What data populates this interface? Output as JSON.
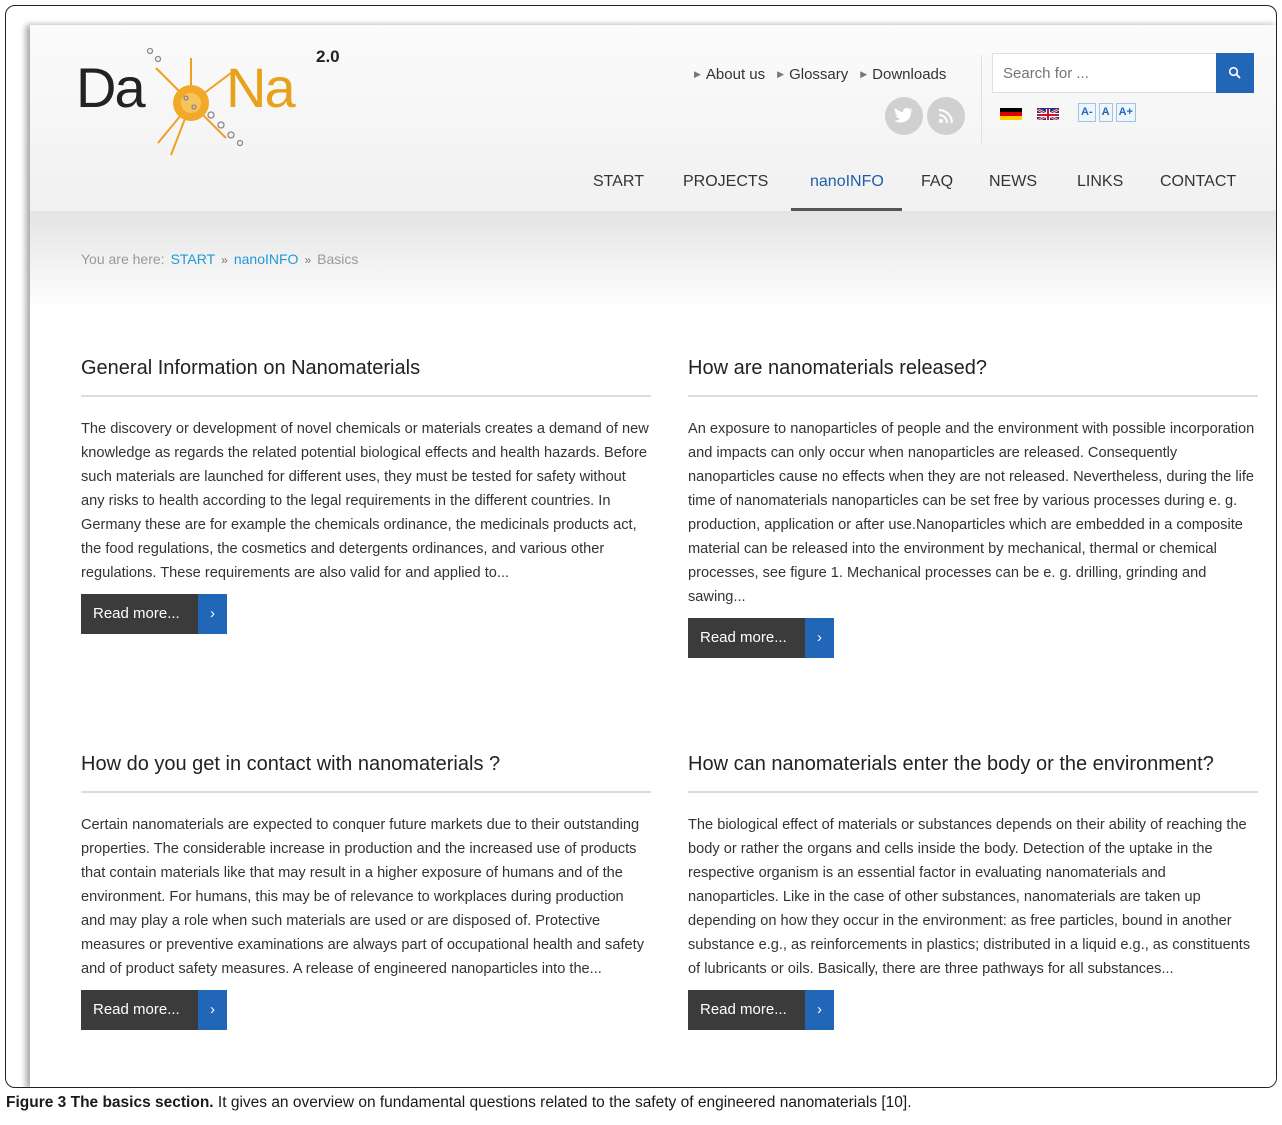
{
  "logo": {
    "brand_left": "Da",
    "brand_right": "Na",
    "version": "2.0"
  },
  "top_links": [
    "About us",
    "Glossary",
    "Downloads"
  ],
  "search": {
    "placeholder": "Search for ..."
  },
  "font_size_controls": [
    "A-",
    "A",
    "A+"
  ],
  "nav": {
    "items": [
      "START",
      "PROJECTS",
      "nanoINFO",
      "FAQ",
      "NEWS",
      "LINKS",
      "CONTACT"
    ],
    "active": "nanoINFO"
  },
  "breadcrumb": {
    "prefix": "You are here:",
    "items": [
      "START",
      "nanoINFO",
      "Basics"
    ],
    "separator": "»"
  },
  "articles": [
    {
      "title": "General Information on Nanomaterials",
      "body": "The discovery or development of novel chemicals or materials creates a demand of new knowledge as regards the related potential biological effects and health hazards. Before such materials are launched for different uses, they must be tested for safety without any risks to health according to the legal requirements in the different countries. In Germany these are for example the chemicals ordinance, the medicinals products act, the food regulations, the cosmetics and detergents ordinances, and various other regulations. These requirements are also valid for and applied to...",
      "read_more": "Read more..."
    },
    {
      "title": "How are nanomaterials released?",
      "body": "An exposure to nanoparticles of people and the environment with possible incorporation and impacts can only occur when nanoparticles are released. Consequently nanoparticles cause no effects when they are not released. Nevertheless, during the life time of nanomaterials nanoparticles can be set free by various processes during e. g. production, application or after use.Nanoparticles which are embedded in a composite material can be released into the environment by mechanical, thermal or chemical processes, see figure 1. Mechanical processes can be e. g. drilling, grinding and sawing...",
      "read_more": "Read more..."
    },
    {
      "title": "How do you get in contact with nanomaterials ?",
      "body": "Certain nanomaterials are expected to conquer future markets due to their outstanding properties. The considerable increase in production and the increased use of products that contain materials like that may result in a higher exposure of humans and of the environment. For humans, this may be of relevance to workplaces during production and may play a role when such materials are used or are disposed of. Protective measures or preventive examinations are always part of occupational health and safety and of product safety measures. A release of engineered nanoparticles into the...",
      "read_more": "Read more..."
    },
    {
      "title": "How can nanomaterials enter the body or the environment?",
      "body": "The biological effect of materials or substances depends on their ability of reaching the body or rather the organs and cells inside the body. Detection of the uptake in the respective organism is an essential factor in evaluating nanomaterials and nanoparticles. Like in the case of other substances, nanomaterials are taken up depending on how they occur in the environment: as free particles, bound in another substance e.g., as reinforcements in plastics; distributed in a liquid e.g., as constituents of lubricants or oils. Basically, there are three pathways for all substances...",
      "read_more": "Read more..."
    }
  ],
  "caption": {
    "label": "Figure 3 The basics section.",
    "text": "It gives an overview on fundamental questions related to the safety of engineered nanomaterials [10]."
  },
  "colors": {
    "accent": "#2266b8",
    "logo_orange": "#e8a11a",
    "link": "#1f9ad6",
    "button_dark": "#3b3b3b"
  }
}
